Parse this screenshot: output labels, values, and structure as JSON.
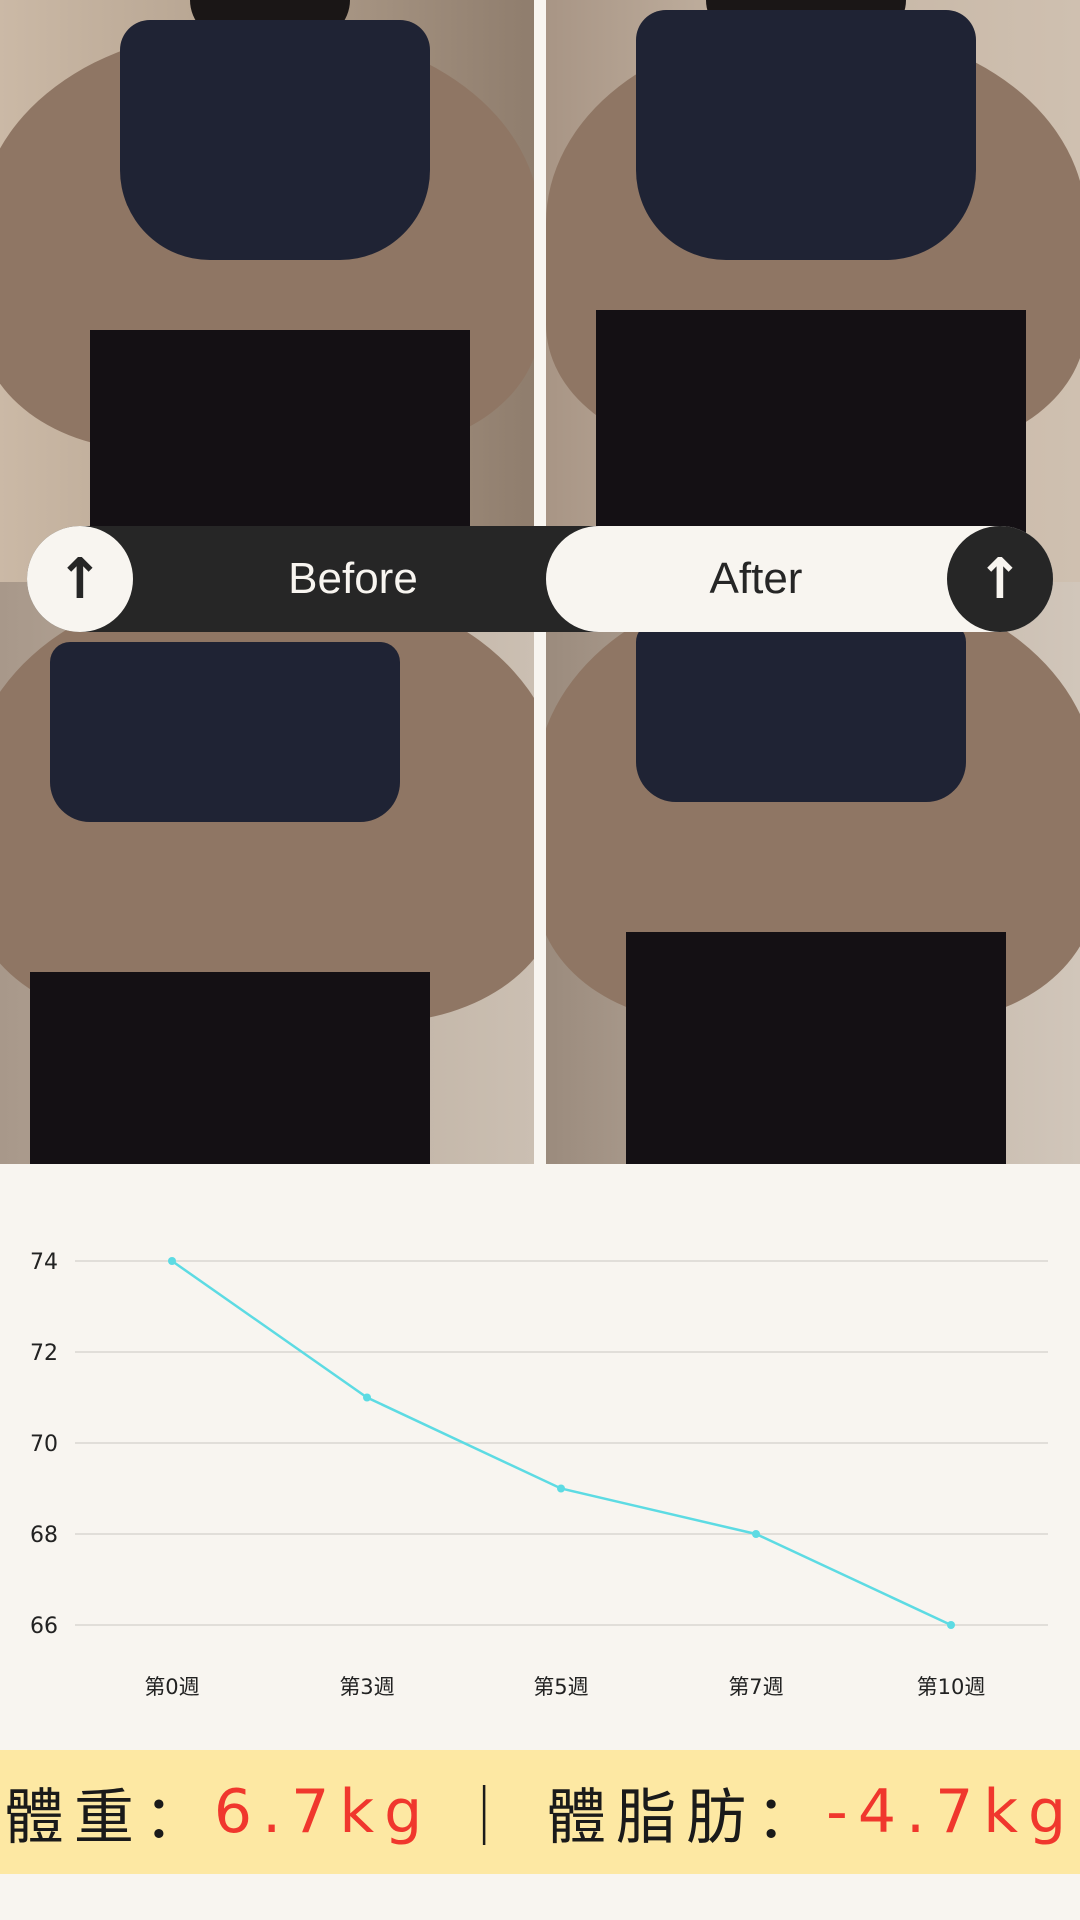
{
  "toggle": {
    "before_label": "Before",
    "after_label": "After",
    "left_icon": "arrow-up-icon",
    "right_icon": "arrow-up-icon"
  },
  "chart_data": {
    "type": "line",
    "categories": [
      "第0週",
      "第3週",
      "第5週",
      "第7週",
      "第10週"
    ],
    "values": [
      74,
      71,
      69,
      68,
      66
    ],
    "ylim": [
      66,
      74
    ],
    "yticks": [
      "74",
      "72",
      "70",
      "68",
      "66"
    ],
    "grid": true,
    "line_color": "#5ddbe3"
  },
  "summary": {
    "weight_label": "體重：",
    "weight_value": "6.7kg",
    "separator": "｜",
    "fat_label": "體脂肪：",
    "fat_value": "-4.7kg"
  },
  "colors": {
    "background": "#f8f5f0",
    "dark": "#262626",
    "highlight": "#fde8a3",
    "accent_red": "#f0372d"
  }
}
